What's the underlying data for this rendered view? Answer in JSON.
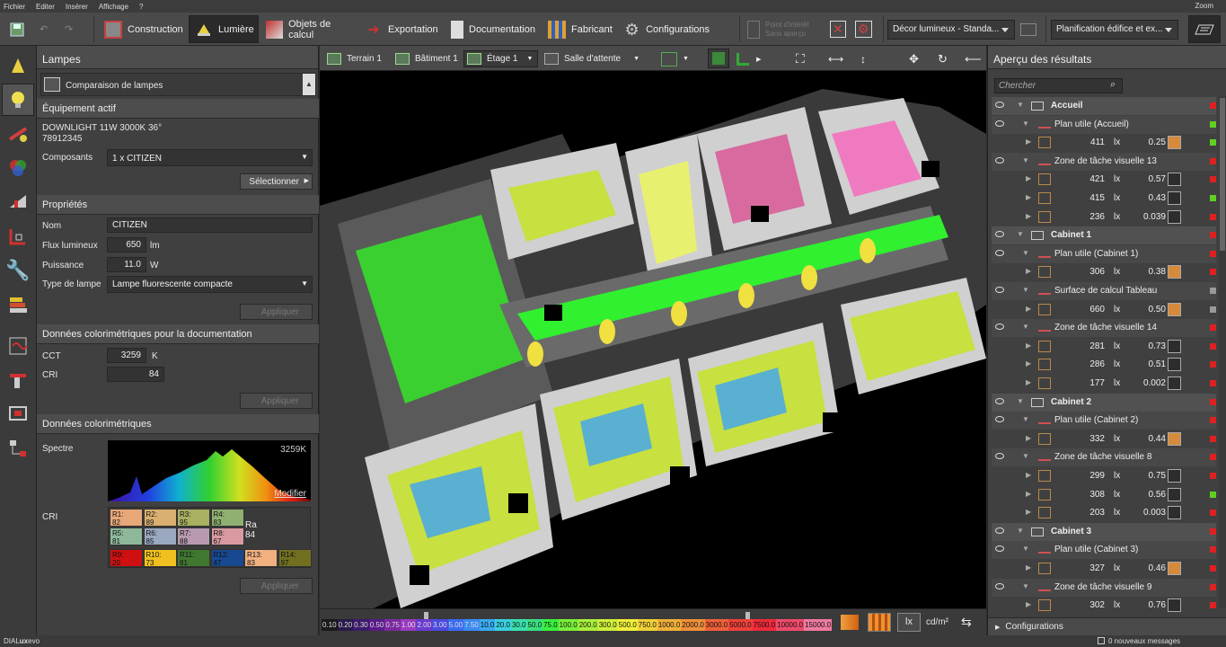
{
  "menu": {
    "items": [
      "Fichier",
      "Editer",
      "Insérer",
      "Affichage",
      "?"
    ],
    "zoom": "Zoom"
  },
  "toolbar": {
    "construction": "Construction",
    "lumiere": "Lumière",
    "objets": "Objets de calcul",
    "exportation": "Exportation",
    "documentation": "Documentation",
    "fabricant": "Fabricant",
    "configurations": "Configurations",
    "pointview": "Point d'intérêt",
    "pointview2": "Sans aperçu",
    "decor": "Décor lumineux - Standa...",
    "planif": "Planification édifice et ex..."
  },
  "left": {
    "title": "Lampes",
    "comparison": "Comparaison de lampes",
    "active_section": "Équipement actif",
    "lamp_name": "DOWNLIGHT 11W 3000K 36°",
    "lamp_code": "78912345",
    "components_label": "Composants",
    "components_value": "1 x CITIZEN",
    "select_btn": "Sélectionner",
    "props_section": "Propriétés",
    "name_label": "Nom",
    "name_value": "CITIZEN",
    "flux_label": "Flux lumineux",
    "flux_value": "650",
    "flux_unit": "lm",
    "power_label": "Puissance",
    "power_value": "11.0",
    "power_unit": "W",
    "type_label": "Type de lampe",
    "type_value": "Lampe fluorescente compacte",
    "apply": "Appliquer",
    "colordoc_section": "Données colorimétriques pour la documentation",
    "cct_label": "CCT",
    "cct_value": "3259",
    "cct_unit": "K",
    "cri_label": "CRI",
    "cri_value": "84",
    "color_section": "Données colorimétriques",
    "spectrum_label": "Spectre",
    "spectrum_k": "3259K",
    "modify": "Modifier",
    "cri_grid_label": "CRI",
    "cri_cells": [
      {
        "label": "R1:",
        "value": "82",
        "color": "#e8a878"
      },
      {
        "label": "R2:",
        "value": "89",
        "color": "#d9b070"
      },
      {
        "label": "R3:",
        "value": "95",
        "color": "#a9b060"
      },
      {
        "label": "R4:",
        "value": "83",
        "color": "#8fb070"
      },
      {
        "label": "R5:",
        "value": "81",
        "color": "#8fb89a"
      },
      {
        "label": "R6:",
        "value": "85",
        "color": "#9aa8c0"
      },
      {
        "label": "R7:",
        "value": "88",
        "color": "#b89ab0"
      },
      {
        "label": "R8:",
        "value": "67",
        "color": "#d89aa0"
      },
      {
        "label": "R9:",
        "value": "20",
        "color": "#d01010"
      },
      {
        "label": "R10:",
        "value": "73",
        "color": "#f0c020"
      },
      {
        "label": "R11:",
        "value": "81",
        "color": "#407830"
      },
      {
        "label": "R12:",
        "value": "47",
        "color": "#184890"
      },
      {
        "label": "R13:",
        "value": "83",
        "color": "#f0b080"
      },
      {
        "label": "R14:",
        "value": "97",
        "color": "#707020"
      }
    ],
    "ra_label": "Ra",
    "ra_value": "84"
  },
  "view": {
    "tabs": [
      "Terrain 1",
      "Bâtiment 1",
      "Étage 1",
      "Salle d'attente"
    ],
    "scale": [
      {
        "v": "0.10",
        "c": "#1a1a1a"
      },
      {
        "v": "0.20",
        "c": "#2a1a4a"
      },
      {
        "v": "0.30",
        "c": "#3a1a6a"
      },
      {
        "v": "0.50",
        "c": "#5a1a8a"
      },
      {
        "v": "0.75",
        "c": "#7a2aa0"
      },
      {
        "v": "1.00",
        "c": "#9a3ac0"
      },
      {
        "v": "2.00",
        "c": "#6a3ad0"
      },
      {
        "v": "3.00",
        "c": "#4a4ae0"
      },
      {
        "v": "5.00",
        "c": "#3a6af0"
      },
      {
        "v": "7.50",
        "c": "#3a8af0"
      },
      {
        "v": "10.0",
        "c": "#3aaaf0"
      },
      {
        "v": "20.0",
        "c": "#3ad0e0"
      },
      {
        "v": "30.0",
        "c": "#3ae0b0"
      },
      {
        "v": "50.0",
        "c": "#3ae080"
      },
      {
        "v": "75.0",
        "c": "#3af040"
      },
      {
        "v": "100.0",
        "c": "#7af03a"
      },
      {
        "v": "200.0",
        "c": "#aaf03a"
      },
      {
        "v": "300.0",
        "c": "#d0f03a"
      },
      {
        "v": "500.0",
        "c": "#f0f03a"
      },
      {
        "v": "750.0",
        "c": "#f0d03a"
      },
      {
        "v": "1000.0",
        "c": "#f0b03a"
      },
      {
        "v": "2000.0",
        "c": "#f0903a"
      },
      {
        "v": "3000.0",
        "c": "#f0603a"
      },
      {
        "v": "5000.0",
        "c": "#f0403a"
      },
      {
        "v": "7500.0",
        "c": "#f02a3a"
      },
      {
        "v": "10000.0",
        "c": "#f04a6a"
      },
      {
        "v": "15000.0",
        "c": "#f07aa0"
      }
    ],
    "unit_lx": "lx",
    "unit_cd": "cd/m²"
  },
  "right": {
    "title": "Aperçu des résultats",
    "search_placeholder": "Chercher",
    "rows": [
      {
        "kind": "room",
        "name": "Accueil",
        "color": "#e02020"
      },
      {
        "kind": "plane",
        "name": "Plan utile (Accueil)",
        "color": "#60d020"
      },
      {
        "kind": "val",
        "value": "411",
        "unit": "lx",
        "ratio": "0.25",
        "gi": "o",
        "color": "#60d020"
      },
      {
        "kind": "plane",
        "name": "Zone de tâche visuelle 13",
        "color": "#e02020"
      },
      {
        "kind": "val",
        "value": "421",
        "unit": "lx",
        "ratio": "0.57",
        "gi": "",
        "color": "#e02020"
      },
      {
        "kind": "val",
        "value": "415",
        "unit": "lx",
        "ratio": "0.43",
        "gi": "",
        "color": "#60d020"
      },
      {
        "kind": "val",
        "value": "236",
        "unit": "lx",
        "ratio": "0.039",
        "gi": "",
        "color": "#e02020"
      },
      {
        "kind": "room",
        "name": "Cabinet 1",
        "color": "#e02020"
      },
      {
        "kind": "plane",
        "name": "Plan utile (Cabinet 1)",
        "color": "#e02020"
      },
      {
        "kind": "val",
        "value": "306",
        "unit": "lx",
        "ratio": "0.38",
        "gi": "o",
        "color": "#e02020"
      },
      {
        "kind": "plane",
        "name": "Surface de calcul Tableau",
        "color": "#999999"
      },
      {
        "kind": "val",
        "value": "660",
        "unit": "lx",
        "ratio": "0.50",
        "gi": "o",
        "color": "#999999"
      },
      {
        "kind": "plane",
        "name": "Zone de tâche visuelle 14",
        "color": "#e02020"
      },
      {
        "kind": "val",
        "value": "281",
        "unit": "lx",
        "ratio": "0.73",
        "gi": "",
        "color": "#e02020"
      },
      {
        "kind": "val",
        "value": "286",
        "unit": "lx",
        "ratio": "0.51",
        "gi": "",
        "color": "#e02020"
      },
      {
        "kind": "val",
        "value": "177",
        "unit": "lx",
        "ratio": "0.002",
        "gi": "",
        "color": "#e02020"
      },
      {
        "kind": "room",
        "name": "Cabinet 2",
        "color": "#e02020"
      },
      {
        "kind": "plane",
        "name": "Plan utile (Cabinet 2)",
        "color": "#e02020"
      },
      {
        "kind": "val",
        "value": "332",
        "unit": "lx",
        "ratio": "0.44",
        "gi": "o",
        "color": "#e02020"
      },
      {
        "kind": "plane",
        "name": "Zone de tâche visuelle 8",
        "color": "#e02020"
      },
      {
        "kind": "val",
        "value": "299",
        "unit": "lx",
        "ratio": "0.75",
        "gi": "",
        "color": "#e02020"
      },
      {
        "kind": "val",
        "value": "308",
        "unit": "lx",
        "ratio": "0.56",
        "gi": "",
        "color": "#60d020"
      },
      {
        "kind": "val",
        "value": "203",
        "unit": "lx",
        "ratio": "0.003",
        "gi": "",
        "color": "#e02020"
      },
      {
        "kind": "room",
        "name": "Cabinet 3",
        "color": "#e02020"
      },
      {
        "kind": "plane",
        "name": "Plan utile (Cabinet 3)",
        "color": "#e02020"
      },
      {
        "kind": "val",
        "value": "327",
        "unit": "lx",
        "ratio": "0.46",
        "gi": "o",
        "color": "#e02020"
      },
      {
        "kind": "plane",
        "name": "Zone de tâche visuelle 9",
        "color": "#e02020"
      },
      {
        "kind": "val",
        "value": "302",
        "unit": "lx",
        "ratio": "0.76",
        "gi": "",
        "color": "#e02020"
      }
    ],
    "configurations": "Configurations"
  },
  "status": {
    "brand_a": "DIAL",
    "brand_b": "ux",
    "brand_c": "evo",
    "messages": "0 nouveaux messages"
  }
}
